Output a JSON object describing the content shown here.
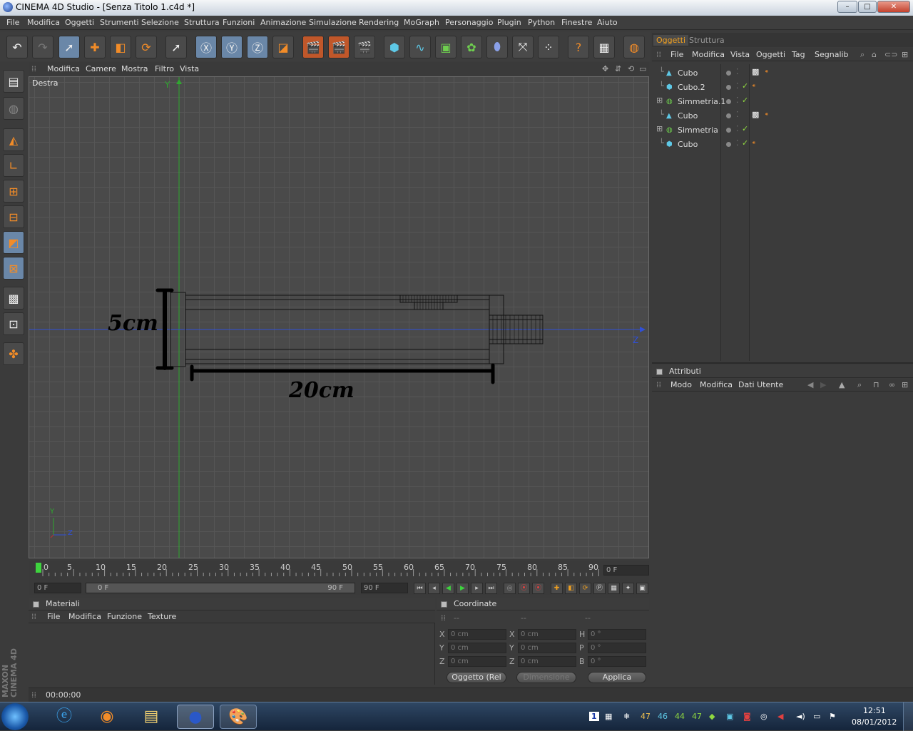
{
  "window": {
    "title": "CINEMA 4D Studio - [Senza Titolo 1.c4d *]",
    "min": "–",
    "max": "□",
    "close": "✕"
  },
  "menu": [
    "File",
    "Modifica",
    "Oggetti",
    "Strumenti",
    "Selezione",
    "Struttura",
    "Funzioni",
    "Animazione",
    "Simulazione",
    "Rendering",
    "MoGraph",
    "Personaggio",
    "Plugin",
    "Python",
    "Finestre",
    "Aiuto"
  ],
  "viewport": {
    "menu": [
      "Modifica",
      "Camere",
      "Mostra",
      "Filtro",
      "Vista"
    ],
    "name": "Destra",
    "axis_y": "Y",
    "axis_z": "Z",
    "mini_y": "Y",
    "mini_z": "Z",
    "annotation_height": "5cm",
    "annotation_length": "20cm"
  },
  "timeline": {
    "ticks": [
      "0",
      "5",
      "10",
      "15",
      "20",
      "25",
      "30",
      "35",
      "40",
      "45",
      "50",
      "55",
      "60",
      "65",
      "70",
      "75",
      "80",
      "85",
      "90"
    ],
    "current_frame": "0 F",
    "start": "0 F",
    "range_start": "0 F",
    "range_end": "90 F",
    "end": "90 F"
  },
  "objects": {
    "tabs": [
      "Oggetti",
      "Struttura"
    ],
    "menu": [
      "File",
      "Modifica",
      "Vista",
      "Oggetti",
      "Tag",
      "Segnalib"
    ],
    "items": [
      {
        "name": "Cubo",
        "type": "cone"
      },
      {
        "name": "Cubo.2",
        "type": "cube"
      },
      {
        "name": "Simmetria.1",
        "type": "symmetry"
      },
      {
        "name": "Cubo",
        "type": "cone"
      },
      {
        "name": "Simmetria",
        "type": "symmetry"
      },
      {
        "name": "Cubo",
        "type": "cube"
      }
    ]
  },
  "attributes": {
    "title": "Attributi",
    "menu": [
      "Modo",
      "Modifica",
      "Dati Utente"
    ]
  },
  "materials": {
    "title": "Materiali",
    "menu": [
      "File",
      "Modifica",
      "Funzione",
      "Texture"
    ]
  },
  "coordinates": {
    "title": "Coordinate",
    "headers": [
      "--",
      "--",
      "--"
    ],
    "rows": [
      {
        "a": "X",
        "av": "0 cm",
        "b": "X",
        "bv": "0 cm",
        "c": "H",
        "cv": "0 °"
      },
      {
        "a": "Y",
        "av": "0 cm",
        "b": "Y",
        "bv": "0 cm",
        "c": "P",
        "cv": "0 °"
      },
      {
        "a": "Z",
        "av": "0 cm",
        "b": "Z",
        "bv": "0 cm",
        "c": "B",
        "cv": "0 °"
      }
    ],
    "mode": "Oggetto (Rel",
    "size": "Dimensione",
    "apply": "Applica"
  },
  "status": {
    "time": "00:00:00"
  },
  "brand": {
    "line1": "MAXON",
    "line2": "CINEMA 4D"
  },
  "taskbar": {
    "time": "12:51",
    "date": "08/01/2012",
    "lang": "1",
    "temps": [
      "47",
      "46",
      "44",
      "47"
    ]
  }
}
